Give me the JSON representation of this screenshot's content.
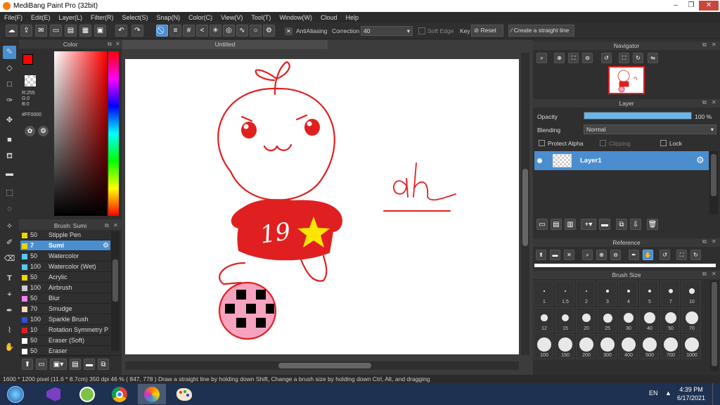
{
  "window": {
    "title": "MediBang Paint Pro (32bit)",
    "minimize": "–",
    "maximize": "❐",
    "close": "✕"
  },
  "menu": [
    "File(F)",
    "Edit(E)",
    "Layer(L)",
    "Filter(R)",
    "Select(S)",
    "Snap(N)",
    "Color(C)",
    "View(V)",
    "Tool(T)",
    "Window(W)",
    "Cloud",
    "Help"
  ],
  "toolbar": {
    "antialias_label": "AntiAliasing",
    "correction_label": "Correction",
    "correction_value": "40",
    "soft_edge_label": "Soft Edge",
    "key_label": "Key",
    "reset_label": "Reset",
    "straight_line_label": "Create a straight line"
  },
  "color_panel": {
    "title": "Color",
    "r": "R:255",
    "g": "G:0",
    "b": "B:0",
    "hex": "#FF0000",
    "primary": "#ff0000"
  },
  "brush_panel": {
    "title": "Brush: Sumi",
    "items": [
      {
        "size": "50",
        "name": "Stipple Pen",
        "swatch": "#e8d800"
      },
      {
        "size": "7",
        "name": "Sumi",
        "swatch": "#e8d800",
        "selected": true
      },
      {
        "size": "50",
        "name": "Watercolor",
        "swatch": "#55c8f0"
      },
      {
        "size": "100",
        "name": "Watercolor (Wet)",
        "swatch": "#55c8f0"
      },
      {
        "size": "50",
        "name": "Acrylic",
        "swatch": "#e8d800"
      },
      {
        "size": "100",
        "name": "Airbrush",
        "swatch": "#cccccc"
      },
      {
        "size": "50",
        "name": "Blur",
        "swatch": "#f080f0"
      },
      {
        "size": "70",
        "name": "Smudge",
        "swatch": "#f8d8c0"
      },
      {
        "size": "100",
        "name": "Sparkle Brush",
        "swatch": "#3050e0"
      },
      {
        "size": "10",
        "name": "Rotation Symmetry P",
        "swatch": "#e02020"
      },
      {
        "size": "50",
        "name": "Eraser (Soft)",
        "swatch": "#ffffff"
      },
      {
        "size": "50",
        "name": "Eraser",
        "swatch": "#ffffff"
      }
    ]
  },
  "canvas_tab": "Untitled",
  "drawing": {
    "text": "ah",
    "number": "19"
  },
  "navigator": {
    "title": "Navigator"
  },
  "layer_panel": {
    "title": "Layer",
    "opacity_label": "Opacity",
    "opacity_value": "100 %",
    "opacity_level": 1.0,
    "blending_label": "Blending",
    "blending_value": "Normal",
    "protect_alpha": "Protect Alpha",
    "clipping": "Clipping",
    "lock": "Lock",
    "layer_name": "Layer1"
  },
  "reference": {
    "title": "Reference"
  },
  "brush_size": {
    "title": "Brush Size",
    "sizes": [
      "1",
      "1.5",
      "2",
      "3",
      "4",
      "5",
      "7",
      "10",
      "12",
      "15",
      "20",
      "25",
      "30",
      "40",
      "50",
      "70",
      "100",
      "150",
      "200",
      "300",
      "400",
      "500",
      "700",
      "1000"
    ]
  },
  "status": {
    "text": "1600 * 1200 pixel   (11.6 * 8.7cm)   350 dpi   46 %   ( 847, 778 )   Draw a straight line by holding down Shift, Change a brush size by holding down Ctrl, Alt, and dragging"
  },
  "taskbar": {
    "lang": "EN",
    "time": "4:39 PM",
    "date": "6/17/2021"
  }
}
